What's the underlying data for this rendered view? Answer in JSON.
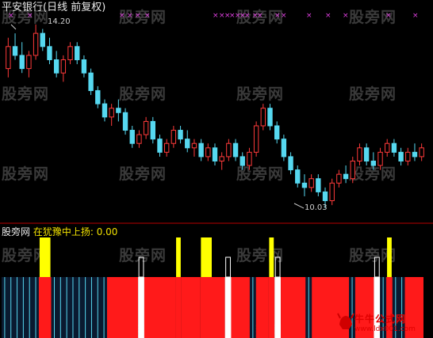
{
  "title": "平安银行(日线 前复权)",
  "price_labels": {
    "max": "14.20",
    "min": "10.03"
  },
  "indicator": {
    "name": "股旁网",
    "label": "在犹豫中上扬:",
    "value": "0.00"
  },
  "watermark": "股旁网",
  "logo": {
    "name": "牛牛公式网",
    "url": "www.ldx001.com"
  },
  "colors": {
    "up": "#ff3a3a",
    "down": "#56d8f0",
    "red_band": "#ff1a1a",
    "yellow": "#ffff00",
    "white": "#ffffff",
    "separator": "#b80000",
    "signal_x": "#e040e0"
  },
  "chart_data": {
    "type": "candlestick",
    "price_range": [
      10.03,
      14.2
    ],
    "candles": [
      [
        13.2,
        13.9,
        13.0,
        13.7
      ],
      [
        13.7,
        14.0,
        13.4,
        13.5
      ],
      [
        13.5,
        13.8,
        13.1,
        13.2
      ],
      [
        13.2,
        13.6,
        13.0,
        13.5
      ],
      [
        13.5,
        14.2,
        13.4,
        14.0
      ],
      [
        14.0,
        14.1,
        13.6,
        13.7
      ],
      [
        13.7,
        13.9,
        13.3,
        13.4
      ],
      [
        13.4,
        13.6,
        13.0,
        13.1
      ],
      [
        13.1,
        13.5,
        12.9,
        13.4
      ],
      [
        13.4,
        13.8,
        13.3,
        13.7
      ],
      [
        13.7,
        13.8,
        13.3,
        13.4
      ],
      [
        13.4,
        13.5,
        13.0,
        13.1
      ],
      [
        13.1,
        13.2,
        12.6,
        12.7
      ],
      [
        12.7,
        12.8,
        12.3,
        12.4
      ],
      [
        12.4,
        12.5,
        12.0,
        12.1
      ],
      [
        12.1,
        12.4,
        11.9,
        12.3
      ],
      [
        12.3,
        12.5,
        12.0,
        12.2
      ],
      [
        12.2,
        12.3,
        11.7,
        11.8
      ],
      [
        11.8,
        11.9,
        11.4,
        11.5
      ],
      [
        11.5,
        11.8,
        11.4,
        11.7
      ],
      [
        11.7,
        12.1,
        11.6,
        12.0
      ],
      [
        12.0,
        12.1,
        11.5,
        11.6
      ],
      [
        11.6,
        11.7,
        11.2,
        11.3
      ],
      [
        11.3,
        11.6,
        11.2,
        11.5
      ],
      [
        11.5,
        11.9,
        11.4,
        11.8
      ],
      [
        11.8,
        11.9,
        11.5,
        11.6
      ],
      [
        11.6,
        11.8,
        11.3,
        11.4
      ],
      [
        11.4,
        11.6,
        11.2,
        11.5
      ],
      [
        11.5,
        11.6,
        11.1,
        11.2
      ],
      [
        11.2,
        11.5,
        11.1,
        11.4
      ],
      [
        11.4,
        11.5,
        11.0,
        11.1
      ],
      [
        11.1,
        11.3,
        10.9,
        11.2
      ],
      [
        11.2,
        11.6,
        11.1,
        11.5
      ],
      [
        11.5,
        11.6,
        11.1,
        11.2
      ],
      [
        11.2,
        11.3,
        10.9,
        11.0
      ],
      [
        11.0,
        11.4,
        10.9,
        11.3
      ],
      [
        11.3,
        12.0,
        11.2,
        11.9
      ],
      [
        11.9,
        12.4,
        11.8,
        12.3
      ],
      [
        12.3,
        12.4,
        11.8,
        11.9
      ],
      [
        11.9,
        12.0,
        11.5,
        11.6
      ],
      [
        11.6,
        11.7,
        11.1,
        11.2
      ],
      [
        11.2,
        11.3,
        10.8,
        10.9
      ],
      [
        10.9,
        11.0,
        10.5,
        10.6
      ],
      [
        10.6,
        10.8,
        10.3,
        10.5
      ],
      [
        10.5,
        10.8,
        10.4,
        10.7
      ],
      [
        10.7,
        10.8,
        10.3,
        10.4
      ],
      [
        10.4,
        10.5,
        10.03,
        10.2
      ],
      [
        10.2,
        10.7,
        10.1,
        10.6
      ],
      [
        10.6,
        10.9,
        10.5,
        10.8
      ],
      [
        10.8,
        11.0,
        10.6,
        10.7
      ],
      [
        10.7,
        11.2,
        10.6,
        11.1
      ],
      [
        11.1,
        11.5,
        11.0,
        11.4
      ],
      [
        11.4,
        11.5,
        11.0,
        11.1
      ],
      [
        11.1,
        11.3,
        10.9,
        11.0
      ],
      [
        11.0,
        11.4,
        10.9,
        11.3
      ],
      [
        11.3,
        11.6,
        11.2,
        11.5
      ],
      [
        11.5,
        11.6,
        11.2,
        11.3
      ],
      [
        11.3,
        11.4,
        11.0,
        11.1
      ],
      [
        11.1,
        11.4,
        11.0,
        11.3
      ],
      [
        11.3,
        11.5,
        11.1,
        11.2
      ],
      [
        11.2,
        11.5,
        11.1,
        11.4
      ]
    ],
    "xlabel": "",
    "ylabel": ""
  },
  "signal_strip": {
    "type": "bar",
    "segments": [
      {
        "kind": "blue",
        "n": 6
      },
      {
        "kind": "yellow",
        "n": 2
      },
      {
        "kind": "blue",
        "n": 9
      },
      {
        "kind": "red",
        "n": 5
      },
      {
        "kind": "white",
        "n": 1
      },
      {
        "kind": "red",
        "n": 5
      },
      {
        "kind": "yellow",
        "n": 1
      },
      {
        "kind": "red",
        "n": 3
      },
      {
        "kind": "yellow",
        "n": 2
      },
      {
        "kind": "red",
        "n": 2
      },
      {
        "kind": "white",
        "n": 1
      },
      {
        "kind": "red",
        "n": 3
      },
      {
        "kind": "blue",
        "n": 1
      },
      {
        "kind": "red",
        "n": 2
      },
      {
        "kind": "yellow",
        "n": 1
      },
      {
        "kind": "white",
        "n": 1
      },
      {
        "kind": "red",
        "n": 4
      },
      {
        "kind": "blue",
        "n": 1
      },
      {
        "kind": "red",
        "n": 6
      },
      {
        "kind": "blue",
        "n": 1
      },
      {
        "kind": "red",
        "n": 3
      },
      {
        "kind": "white",
        "n": 1
      },
      {
        "kind": "blue",
        "n": 1
      },
      {
        "kind": "yellow",
        "n": 1
      },
      {
        "kind": "blue",
        "n": 2
      },
      {
        "kind": "red",
        "n": 3
      }
    ]
  }
}
